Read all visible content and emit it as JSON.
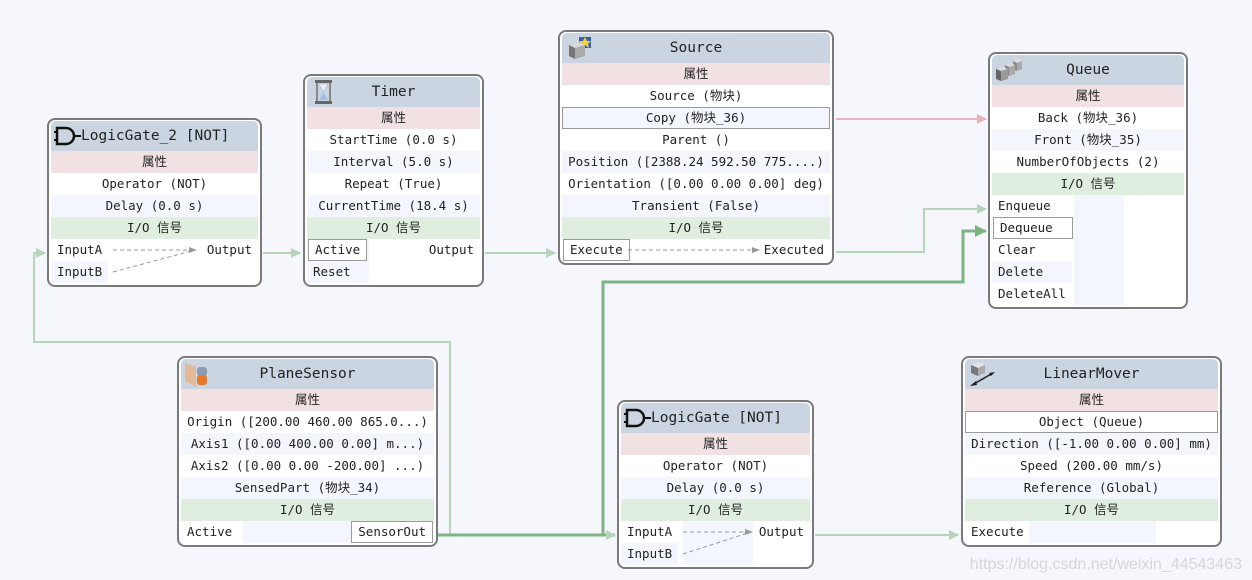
{
  "common": {
    "properties_label": "属性",
    "io_label": "I/O 信号"
  },
  "nodes": {
    "logicgate2": {
      "title": "LogicGate_2 [NOT]",
      "icon": "logic-gate-icon",
      "properties": [
        "Operator (NOT)",
        "Delay (0.0 s)"
      ],
      "inputs": [
        "InputA",
        "InputB"
      ],
      "outputs": [
        "Output"
      ]
    },
    "timer": {
      "title": "Timer",
      "icon": "hourglass-icon",
      "properties": [
        "StartTime (0.0 s)",
        "Interval (5.0 s)",
        "Repeat (True)",
        "CurrentTime (18.4 s)"
      ],
      "inputs": [
        "Active",
        "Reset"
      ],
      "outputs": [
        "Output"
      ]
    },
    "source": {
      "title": "Source",
      "icon": "source-block-icon",
      "properties": [
        "Source (物块)",
        "Copy (物块_36)",
        "Parent ()",
        "Position ([2388.24 592.50 775....)",
        "Orientation ([0.00 0.00 0.00] deg)",
        "Transient (False)"
      ],
      "inputs": [
        "Execute"
      ],
      "outputs": [
        "Executed"
      ]
    },
    "queue": {
      "title": "Queue",
      "icon": "queue-blocks-icon",
      "properties": [
        "Back (物块_36)",
        "Front (物块_35)",
        "NumberOfObjects (2)"
      ],
      "inputs": [
        "Enqueue",
        "Dequeue",
        "Clear",
        "Delete",
        "DeleteAll"
      ],
      "outputs": []
    },
    "planesensor": {
      "title": "PlaneSensor",
      "icon": "plane-sensor-icon",
      "properties": [
        "Origin ([200.00 460.00 865.0...)",
        "Axis1 ([0.00 400.00 0.00] m...)",
        "Axis2 ([0.00 0.00 -200.00] ...)",
        "SensedPart (物块_34)"
      ],
      "inputs": [
        "Active"
      ],
      "outputs": [
        "SensorOut"
      ]
    },
    "logicgate": {
      "title": "LogicGate [NOT]",
      "icon": "logic-gate-icon",
      "properties": [
        "Operator (NOT)",
        "Delay (0.0 s)"
      ],
      "inputs": [
        "InputA",
        "InputB"
      ],
      "outputs": [
        "Output"
      ]
    },
    "linearmover": {
      "title": "LinearMover",
      "icon": "linear-mover-icon",
      "properties": [
        "Object (Queue)",
        "Direction ([-1.00 0.00 0.00] mm)",
        "Speed (200.00 mm/s)",
        "Reference (Global)"
      ],
      "inputs": [
        "Execute"
      ],
      "outputs": []
    }
  },
  "colors": {
    "header": "#cbd5e1",
    "properties_band": "#f1e1e2",
    "io_band": "#e0eedf",
    "wire_light": "#b5d4b9",
    "wire_active": "#7fb386",
    "wire_reference": "#e6b4bc"
  },
  "watermark": "https://blog.csdn.net/weixin_44543463"
}
